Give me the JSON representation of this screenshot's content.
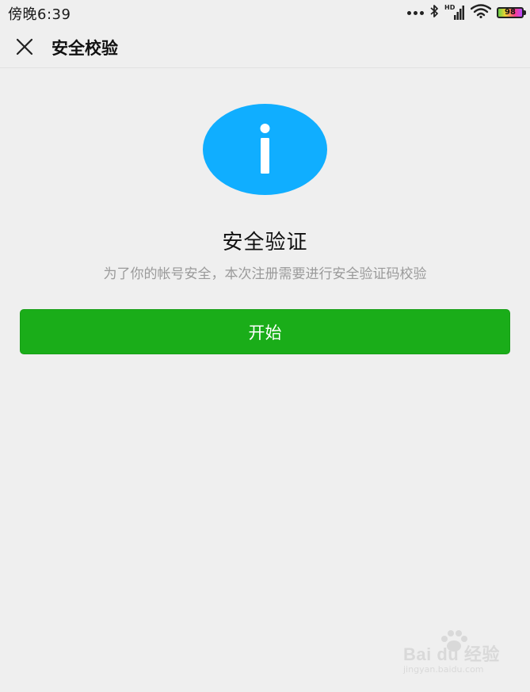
{
  "status_bar": {
    "time": "傍晚6:39",
    "battery_level": "98",
    "signal_label": "HD"
  },
  "header": {
    "title": "安全校验",
    "close_icon": "close-icon"
  },
  "main": {
    "icon": "info-icon",
    "title": "安全验证",
    "description": "为了你的帐号安全，本次注册需要进行安全验证码校验",
    "start_button_label": "开始"
  },
  "watermark": {
    "logo_text": "Bai du 经验",
    "url_text": "jingyan.baidu.com"
  },
  "colors": {
    "background": "#efefef",
    "accent_blue": "#10aeff",
    "primary_green": "#1aad19",
    "text_primary": "#111111",
    "text_secondary": "#9a9a9a"
  }
}
